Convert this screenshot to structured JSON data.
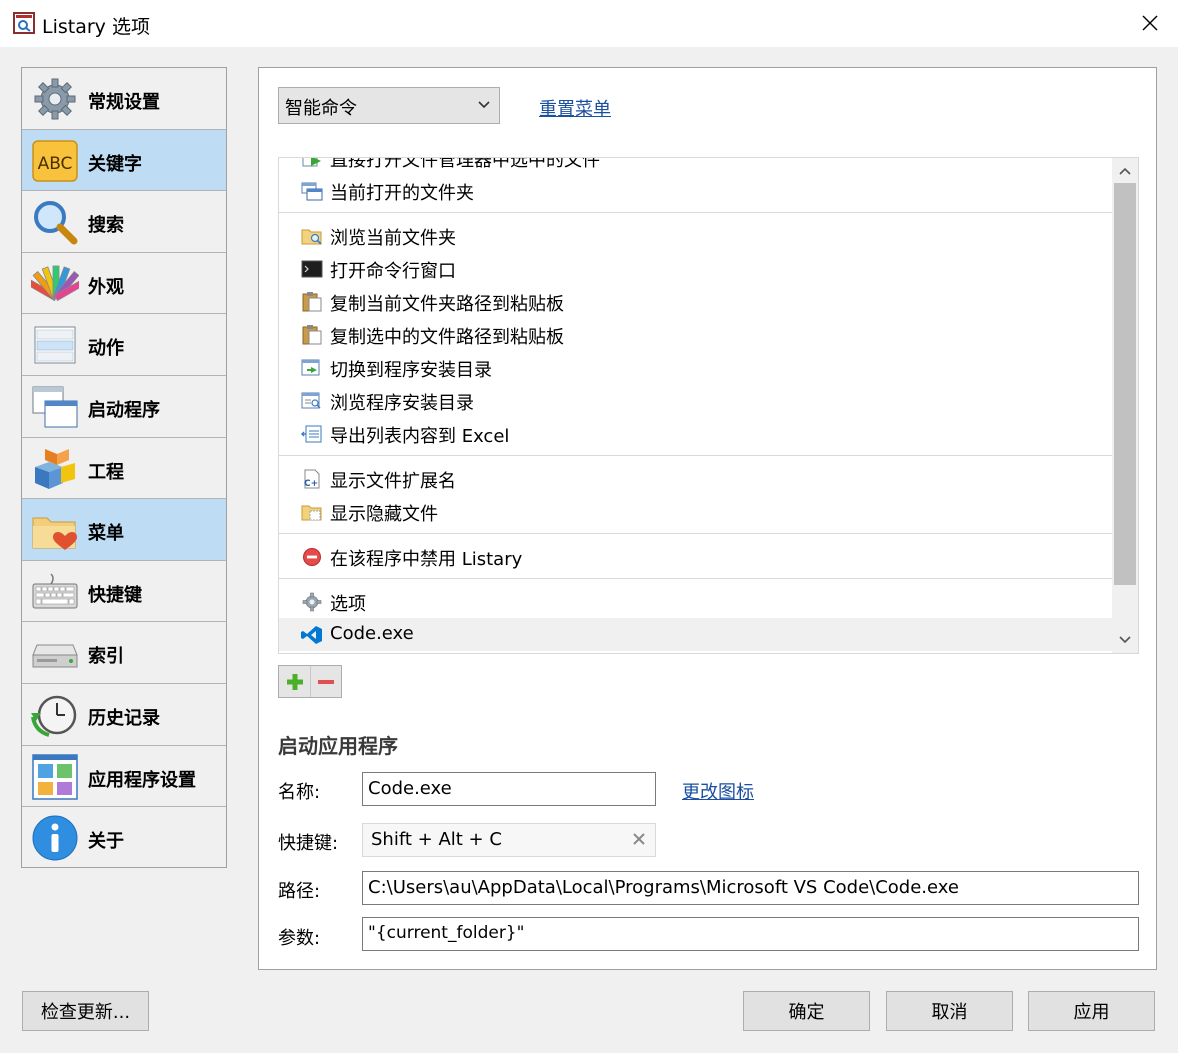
{
  "window": {
    "title": "Listary 选项",
    "close_icon": "close-icon"
  },
  "sidebar": {
    "items": [
      {
        "label": "常规设置",
        "icon": "gear-icon",
        "selected": false
      },
      {
        "label": "关键字",
        "icon": "abc-icon",
        "selected": true
      },
      {
        "label": "搜索",
        "icon": "magnifier-icon",
        "selected": false
      },
      {
        "label": "外观",
        "icon": "color-palette-icon",
        "selected": false
      },
      {
        "label": "动作",
        "icon": "action-list-icon",
        "selected": false
      },
      {
        "label": "启动程序",
        "icon": "launch-window-icon",
        "selected": false
      },
      {
        "label": "工程",
        "icon": "project-boxes-icon",
        "selected": false
      },
      {
        "label": "菜单",
        "icon": "folder-heart-icon",
        "selected": true
      },
      {
        "label": "快捷键",
        "icon": "keyboard-icon",
        "selected": false
      },
      {
        "label": "索引",
        "icon": "drive-icon",
        "selected": false
      },
      {
        "label": "历史记录",
        "icon": "clock-history-icon",
        "selected": false
      },
      {
        "label": "应用程序设置",
        "icon": "app-grid-icon",
        "selected": false
      },
      {
        "label": "关于",
        "icon": "info-icon",
        "selected": false
      }
    ]
  },
  "menu_section": {
    "dropdown_value": "智能命令",
    "reset_link": "重置菜单",
    "list": [
      {
        "type": "item",
        "label": "直接打开文件管理器中选中的文件",
        "icon": "open-file-icon"
      },
      {
        "type": "item",
        "label": "当前打开的文件夹",
        "icon": "windows-icon"
      },
      {
        "type": "sep"
      },
      {
        "type": "item",
        "label": "浏览当前文件夹",
        "icon": "browse-folder-icon"
      },
      {
        "type": "item",
        "label": "打开命令行窗口",
        "icon": "terminal-icon"
      },
      {
        "type": "item",
        "label": "复制当前文件夹路径到粘贴板",
        "icon": "clipboard-icon"
      },
      {
        "type": "item",
        "label": "复制选中的文件路径到粘贴板",
        "icon": "clipboard-icon"
      },
      {
        "type": "item",
        "label": "切换到程序安装目录",
        "icon": "switch-dir-icon"
      },
      {
        "type": "item",
        "label": "浏览程序安装目录",
        "icon": "browse-dir-icon"
      },
      {
        "type": "item",
        "label": "导出列表内容到 Excel",
        "icon": "export-excel-icon"
      },
      {
        "type": "sep"
      },
      {
        "type": "item",
        "label": "显示文件扩展名",
        "icon": "file-ext-icon"
      },
      {
        "type": "item",
        "label": "显示隐藏文件",
        "icon": "hidden-files-icon"
      },
      {
        "type": "sep"
      },
      {
        "type": "item",
        "label": "在该程序中禁用 Listary",
        "icon": "disable-icon"
      },
      {
        "type": "sep"
      },
      {
        "type": "item",
        "label": "选项",
        "icon": "gear-icon"
      },
      {
        "type": "item",
        "label": "Code.exe",
        "icon": "vscode-icon",
        "selected": true
      }
    ],
    "add_icon": "plus-icon",
    "remove_icon": "minus-icon"
  },
  "launch_app": {
    "section_title": "启动应用程序",
    "name_label": "名称:",
    "name_value": "Code.exe",
    "change_icon_link": "更改图标",
    "hotkey_label": "快捷键:",
    "hotkey_value": "Shift + Alt + C",
    "path_label": "路径:",
    "path_value": "C:\\Users\\au\\AppData\\Local\\Programs\\Microsoft VS Code\\Code.exe",
    "params_label": "参数:",
    "params_value": "\"{current_folder}\""
  },
  "buttons": {
    "check_update": "检查更新...",
    "ok": "确定",
    "cancel": "取消",
    "apply": "应用"
  },
  "colors": {
    "selection": "#bfdcf5",
    "link": "#1a4fa1",
    "vscode_blue": "#0078d4"
  }
}
